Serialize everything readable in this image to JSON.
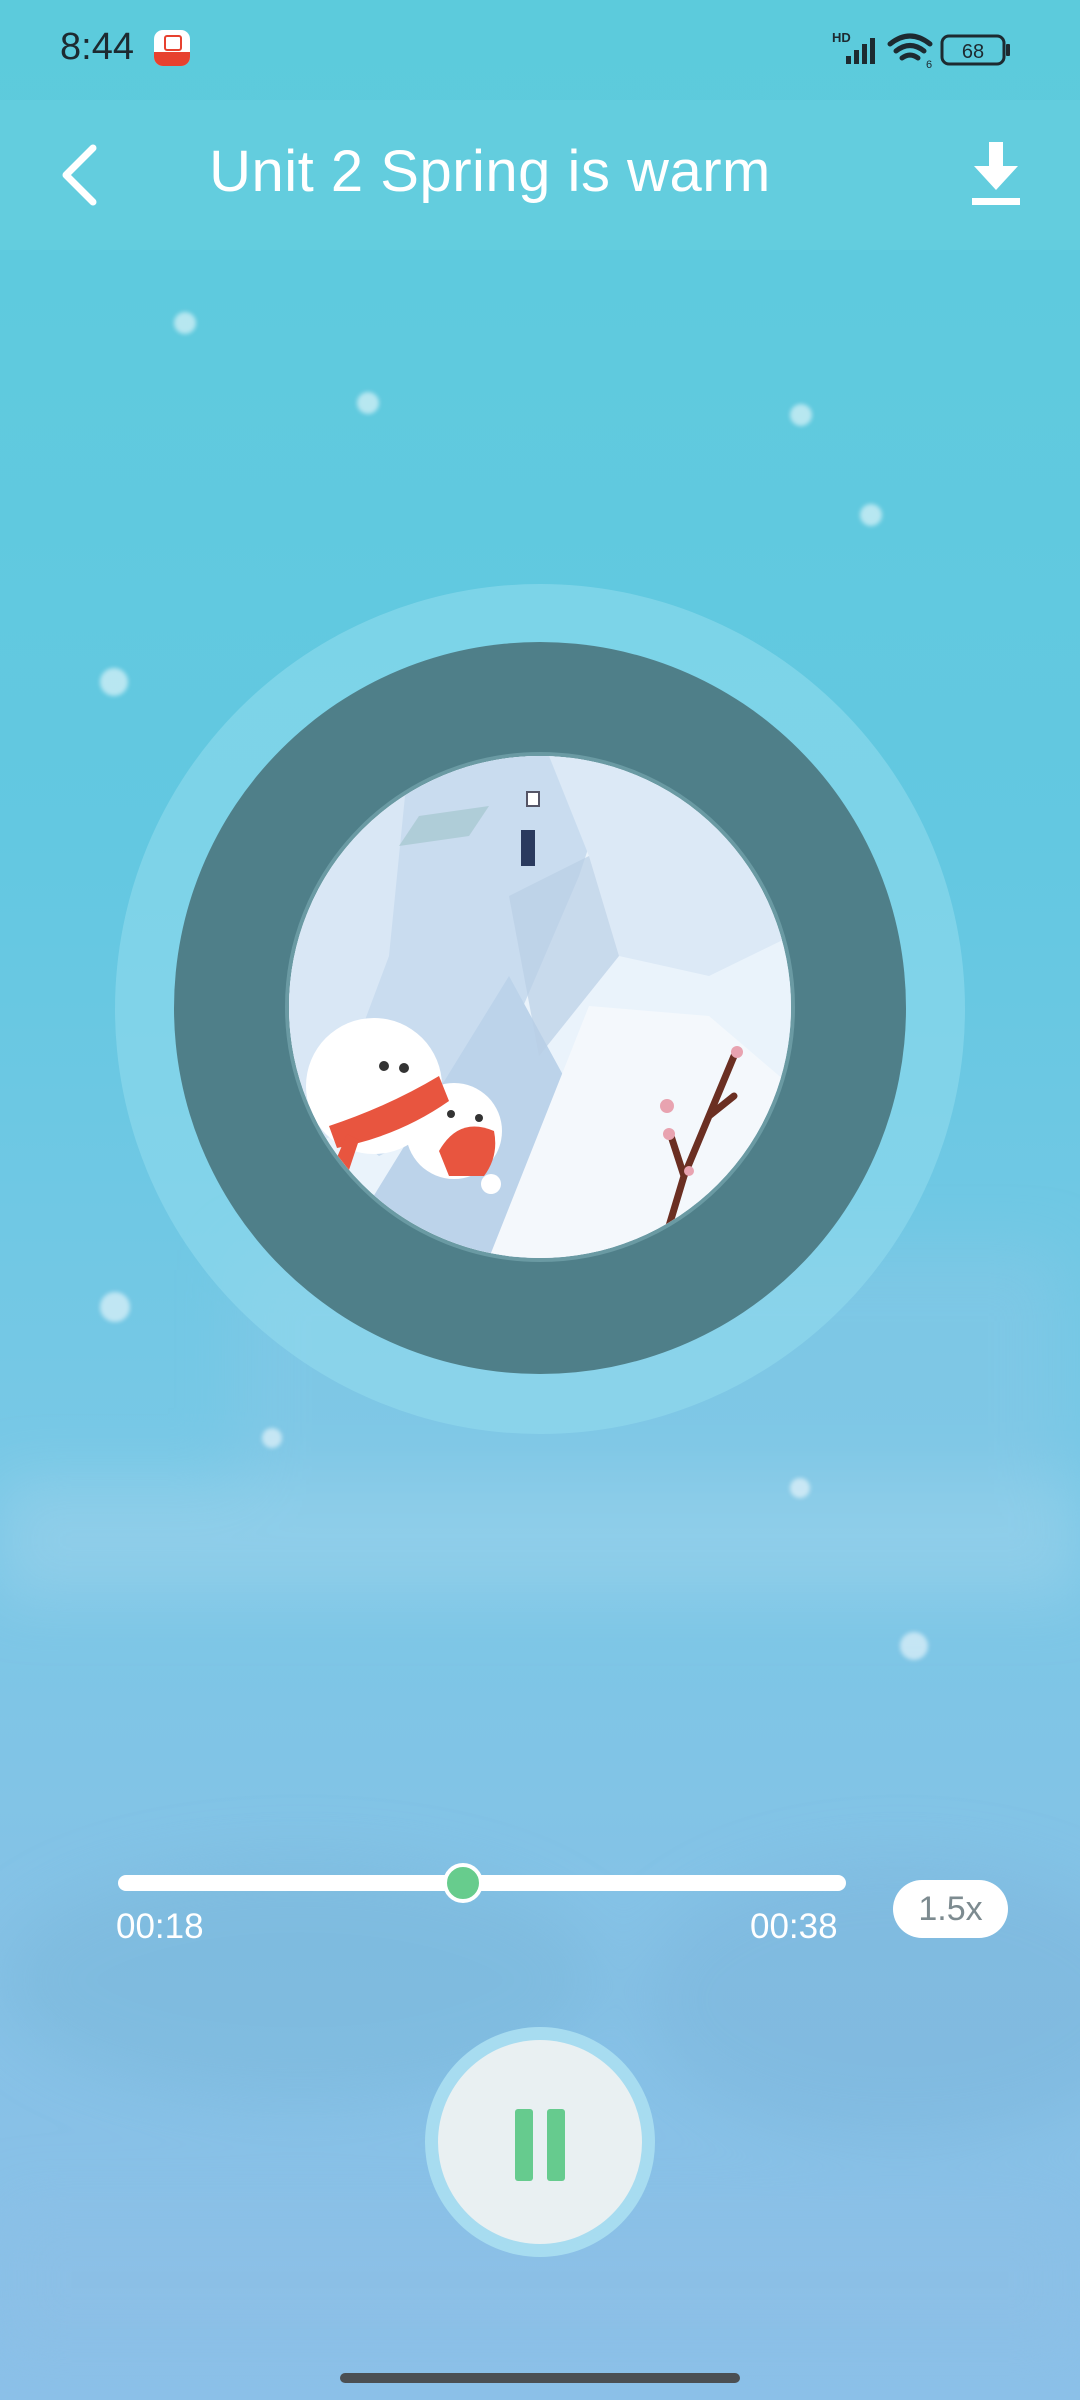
{
  "status_bar": {
    "time": "8:44",
    "battery": "68",
    "network_label": "HD",
    "wifi_label": "6"
  },
  "header": {
    "title": "Unit 2 Spring is warm"
  },
  "player": {
    "current_time": "00:18",
    "total_time": "00:38",
    "progress": 0.474,
    "speed": "1.5x",
    "state": "playing"
  },
  "colors": {
    "accent": "#67cc8d",
    "background": "#63c8e1",
    "disc_ring": "#4f7f89"
  }
}
